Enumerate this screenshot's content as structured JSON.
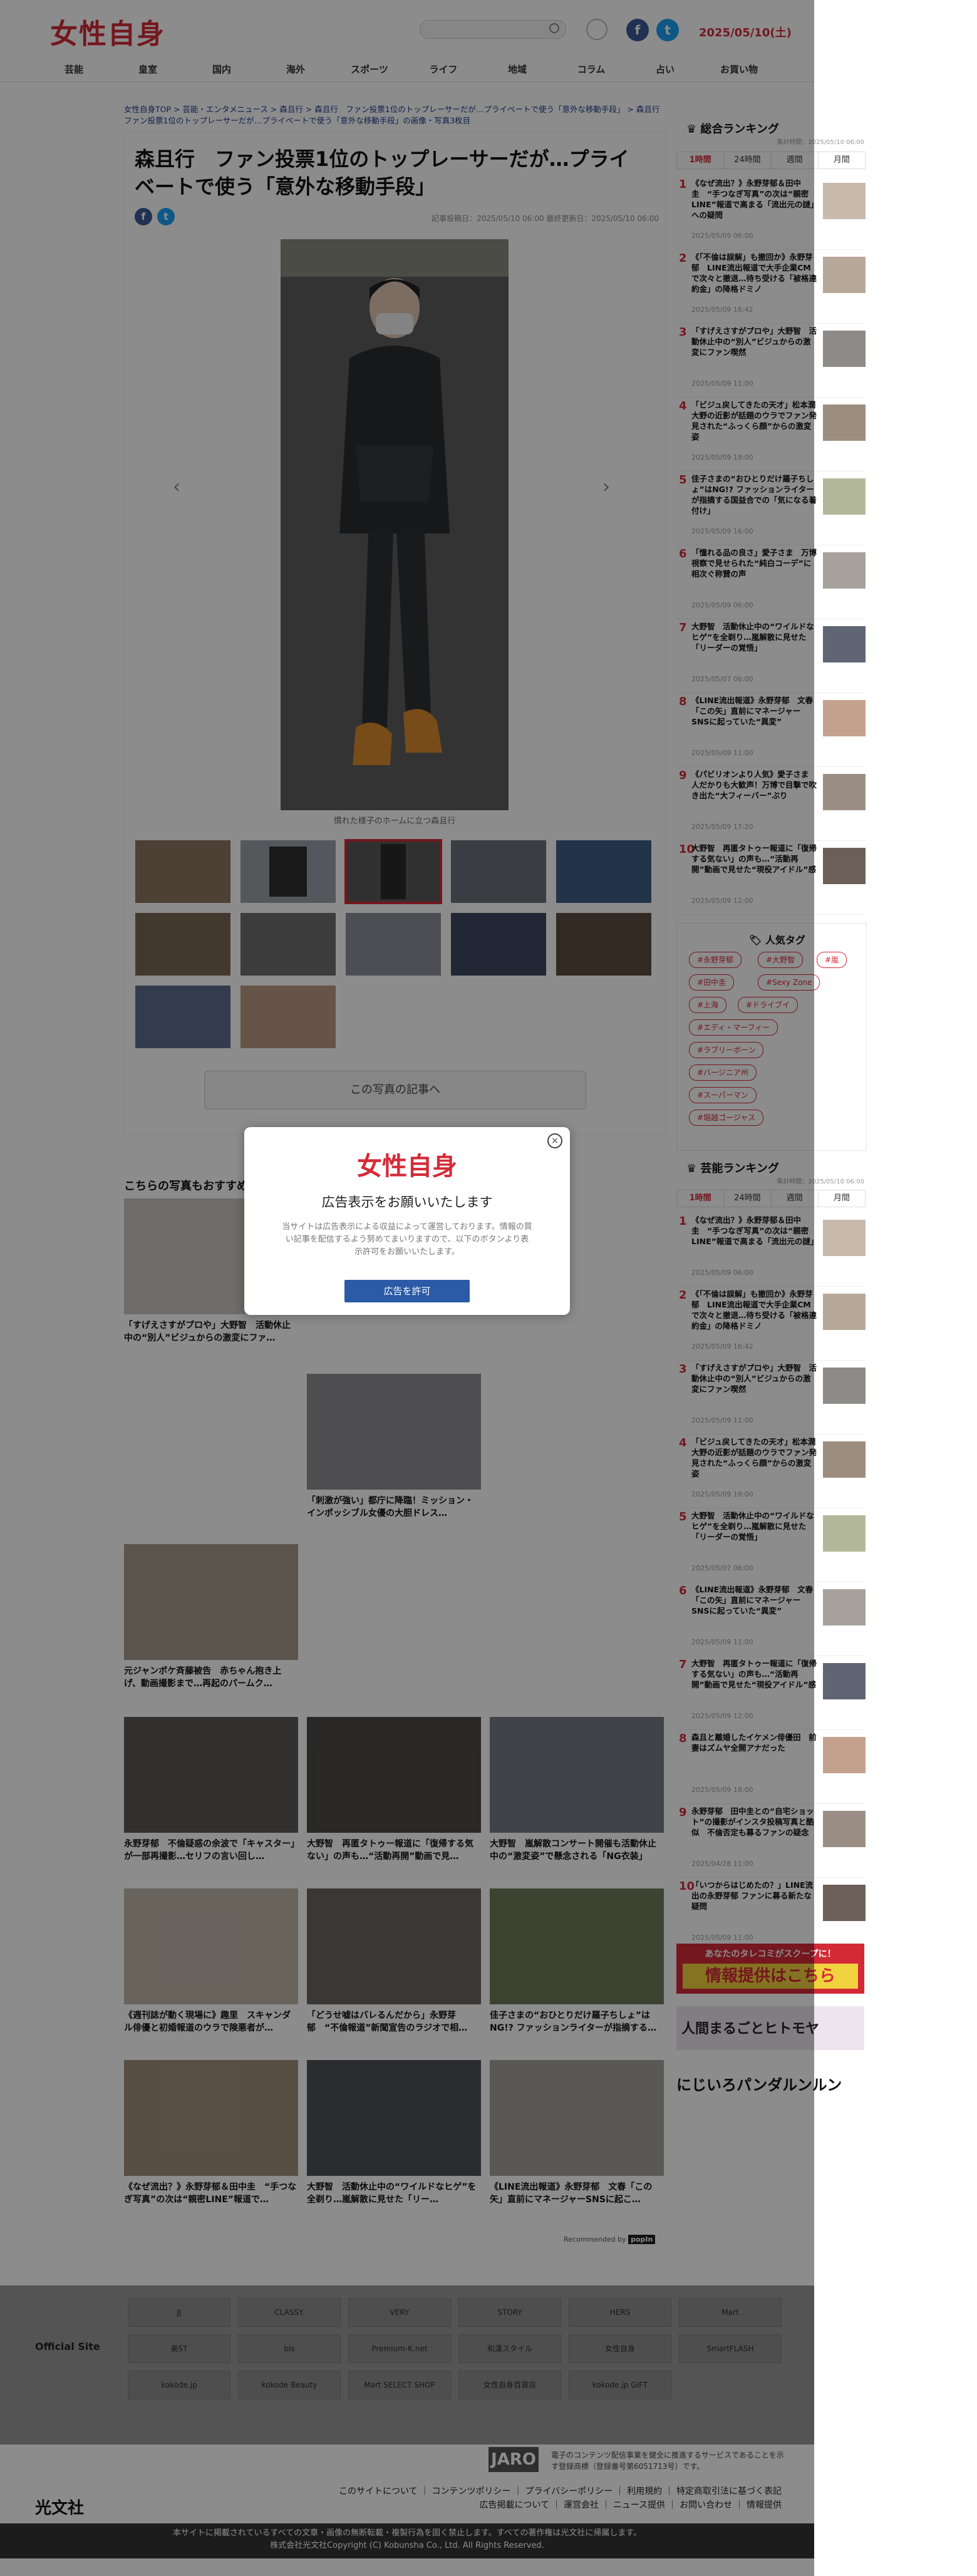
{
  "header": {
    "logo": "女性自身",
    "search_placeholder": "",
    "date": "2025/05/10",
    "date_weekday": "(土)",
    "facebook": "f",
    "twitter": "t"
  },
  "nav": [
    "芸能",
    "皇室",
    "国内",
    "海外",
    "スポーツ",
    "ライフ",
    "地域",
    "コラム",
    "占い",
    "お買い物"
  ],
  "breadcrumb": "女性自身TOP > 芸能・エンタメニュース > 森且行 > 森且行　ファン投票1位のトップレーサーだが…プライベートで使う「意外な移動手段」 > 森且行　ファン投票1位のトップレーサーだが…プライベートで使う「意外な移動手段」の画像・写真3枚目",
  "article": {
    "title": "森且行　ファン投票1位のトップレーサーだが…プライベートで使う「意外な移動手段」",
    "meta": "記事投稿日：2025/05/10 06:00 最終更新日：2025/05/10 06:00",
    "caption": "慣れた様子のホームに立つ森且行",
    "more_button": "この写真の記事へ",
    "prev": "‹",
    "next": "›"
  },
  "recommend": {
    "heading": "こちらの写真もおすすめ",
    "cards": [
      {
        "title": "「すげえさすがプロや」大野智　活動休止中の“別人”ビジュからの激変にファ…",
        "pr": ""
      },
      {
        "title": "「刺激が強い」都庁に降臨！ミッション・インポッシブル女優の大胆ドレス…",
        "pr": ""
      },
      {
        "title": "元ジャンポケ斉藤被告　赤ちゃん抱き上げ、動画撮影まで…再起のパームク…",
        "pr": ""
      },
      {
        "title": "永野芽郁　不倫疑惑の余波で「キャスター」が一部再撮影…セリフの言い回し…",
        "pr": ""
      },
      {
        "title": "大野智　再匿タトゥー報道に「復帰する気ない」の声も…“活動再開”動画で見…",
        "pr": ""
      },
      {
        "title": "大野智　嵐解散コンサート開催も活動休止中の“激変姿”で懸念される「NG衣装」",
        "pr": ""
      },
      {
        "title": "《週刊誌が動く現場に》趣里　スキャンダル俳優と初婚報道のウラで険悪者が…",
        "pr": ""
      },
      {
        "title": "「どうせ嘘はバレるんだから」永野芽郁　“不倫報道”新聞宣告のラジオで相…",
        "pr": ""
      },
      {
        "title": "佳子さまの“おひとりだけ羅子ちしょ”はNG!? ファッションライターが指摘する…",
        "pr": ""
      },
      {
        "title": "《なぜ流出？》永野芽郁＆田中圭　“手つなぎ写真”の次は“親密LINE”報道で…",
        "pr": ""
      },
      {
        "title": "大野智　活動休止中の“ワイルドなヒゲ”を全剃り…嵐解散に見せた「リー…",
        "pr": ""
      },
      {
        "title": "《LINE流出報道》永野芽郁　文春「この矢」直前にマネージャーSNSに起こ…",
        "pr": ""
      }
    ],
    "recommended_by": "Recommended by",
    "popin": "popIn"
  },
  "ranking1": {
    "heading": "総合ランキング",
    "updated": "集計時間：2025/05/10 06:00",
    "tabs": [
      "1時間",
      "24時間",
      "週間",
      "月間"
    ],
    "items": [
      {
        "n": "1",
        "t": "《なぜ流出？》永野芽郁＆田中圭　“手つなぎ写真”の次は“親密LINE”報道で高まる「流出元の謎」への疑問",
        "d": "2025/05/09 06:00"
      },
      {
        "n": "2",
        "t": "《「不倫は誤解」も撤回か》永野芽郁　LINE流出報道で大手企業CMで次々と撤退…待ち受ける「被格違約金」の降格ドミノ",
        "d": "2025/05/09 16:42"
      },
      {
        "n": "3",
        "t": "「すげえさすがプロや」大野智　活動休止中の“別人”ビジュからの激変にファン喫然",
        "d": "2025/05/09 11:00"
      },
      {
        "n": "4",
        "t": "「ビジュ戻してきたの天才」松本潤　大野の近影が話題のウラでファン発見された“ふっくら顔”からの激変姿",
        "d": "2025/05/09 19:00"
      },
      {
        "n": "5",
        "t": "佳子さまの“おひとりだけ羅子ちしょ”はNG!? ファッションライターが指摘する国益合での「気になる着付け」",
        "d": "2025/05/09 16:00"
      },
      {
        "n": "6",
        "t": "「憧れる品の良さ」愛子さま　万博視察で見せられた“純白コーデ”に相次ぐ称賛の声",
        "d": "2025/05/09 06:00"
      },
      {
        "n": "7",
        "t": "大野智　活動休止中の“ワイルドなヒゲ”を全剃り…嵐解散に見せた「リーダーの覚悟」",
        "d": "2025/05/07 06:00"
      },
      {
        "n": "8",
        "t": "《LINE流出報道》永野芽郁　文春「この矢」直前にマネージャーSNSに起っていた“異変”",
        "d": "2025/05/09 11:00"
      },
      {
        "n": "9",
        "t": "《パビリオンより人気》愛子さま　人だかりも大歓声！万博で目撃で吹き出た“大フィーバー”ぶり",
        "d": "2025/05/09 17:20"
      },
      {
        "n": "10",
        "t": "大野智　再匿タトゥー報道に「復帰する気ない」の声も…“活動再開”動画で見せた“現役アイドル”感",
        "d": "2025/05/09 12:00"
      }
    ]
  },
  "tags": {
    "heading": "人気タグ",
    "items": [
      "#永野芽郁",
      "#大野智",
      "#嵐",
      "#田中圭",
      "#Sexy Zone",
      "#上海",
      "#ドライブイ",
      "#エディ・マーフィー",
      "#ラブリーボーン",
      "#バージニア州",
      "#スーパーマン",
      "#堀越ゴージャス"
    ]
  },
  "ranking2": {
    "heading": "芸能ランキング",
    "updated": "集計時間：2025/05/10 06:00",
    "tabs": [
      "1時間",
      "24時間",
      "週間",
      "月間"
    ],
    "items": [
      {
        "n": "1",
        "t": "《なぜ流出？》永野芽郁＆田中圭　“手つなぎ写真”の次は“親密LINE”報道で高まる「流出元の謎」",
        "d": "2025/05/09 06:00"
      },
      {
        "n": "2",
        "t": "《「不倫は誤解」も撤回か》永野芽郁　LINE流出報道で大手企業CMで次々と撤退…待ち受ける「被格違約金」の降格ドミノ",
        "d": "2025/05/09 16:42"
      },
      {
        "n": "3",
        "t": "「すげえさすがプロや」大野智　活動休止中の“別人”ビジュからの激変にファン喫然",
        "d": "2025/05/09 11:00"
      },
      {
        "n": "4",
        "t": "「ビジュ戻してきたの天才」松本潤　大野の近影が話題のウラでファン発見された“ふっくら顔”からの激変姿",
        "d": "2025/05/09 19:00"
      },
      {
        "n": "5",
        "t": "大野智　活動休止中の“ワイルドなヒゲ”を全剃り…嵐解散に見せた「リーダーの覚悟」",
        "d": "2025/05/07 06:00"
      },
      {
        "n": "6",
        "t": "《LINE流出報道》永野芽郁　文春「この矢」直前にマネージャーSNSに起っていた“異変”",
        "d": "2025/05/09 11:00"
      },
      {
        "n": "7",
        "t": "大野智　再匿タトゥー報道に「復帰する気ない」の声も…“活動再開”動画で見せた“現役アイドル”感",
        "d": "2025/05/09 12:00"
      },
      {
        "n": "8",
        "t": "森且と離婚したイケメン俳優田　前妻はズムヤ全開アナだった",
        "d": "2025/05/09 18:00"
      },
      {
        "n": "9",
        "t": "永野芽郁　田中圭との“自宅ショット”の撮影がインスタ投稿写真と酷似　不倫否定も募るファンの疑念",
        "d": "2025/04/28 11:00"
      },
      {
        "n": "10",
        "t": "「いつからはじめたの？」LINE流出の永野芽郁 ファンに募る新たな疑問",
        "d": "2025/05/09 11:00"
      }
    ]
  },
  "banners": {
    "tip_line1": "あなたのタレコミがスクープに！",
    "tip_line2": "情報提供はこちら",
    "manga1": "人間まるごとヒトモヤ",
    "manga2": "にじいろパンダルンルン"
  },
  "footer": {
    "official_site": "Official Site",
    "sites": [
      "JJ",
      "CLASSY.",
      "VERY",
      "STORY",
      "HERS",
      "Mart",
      "美ST",
      "bis",
      "Premium-K.net",
      "和漢スタイル",
      "女性自身",
      "SmartFLASH",
      "kokode.jp",
      "kokode Beauty",
      "Mart SELECT SHOP",
      "女性自身百貨店",
      "kokode.jp GIFT"
    ],
    "jaro": "JARO",
    "jaro_text": "電子のコンテンツ配信事業を健全に推進するサービスであることを示す登録商標（登録番号第6051713号）です。",
    "publisher": "光文社",
    "links": [
      "このサイトについて",
      "コンテンツポリシー",
      "プライバシーポリシー",
      "利用規約",
      "特定商取引法に基づく表記",
      "広告掲載について",
      "運営会社",
      "ニュース提供",
      "お問い合わせ",
      "情報提供"
    ],
    "copyright1": "本サイトに掲載されているすべての文章・画像の無断転載・複製行為を固く禁止します。すべての著作権は光文社に帰属します。",
    "copyright2": "株式会社光文社Copyright (C) Kobunsha Co., Ltd. All Rights Reserved."
  },
  "modal": {
    "logo": "女性自身",
    "title": "広告表示をお願いいたします",
    "text": "当サイトは広告表示による収益によって運営しております。情報の質い記事を配信するよう努めてまいりますので、以下のボタンより表示許可をお願いいたします。",
    "button": "広告を許可",
    "close": "×"
  },
  "colors": {
    "brand": "#d42a37",
    "facebook": "#3b5998",
    "twitter": "#1da1f2",
    "modal_button": "#2b5aa6"
  }
}
